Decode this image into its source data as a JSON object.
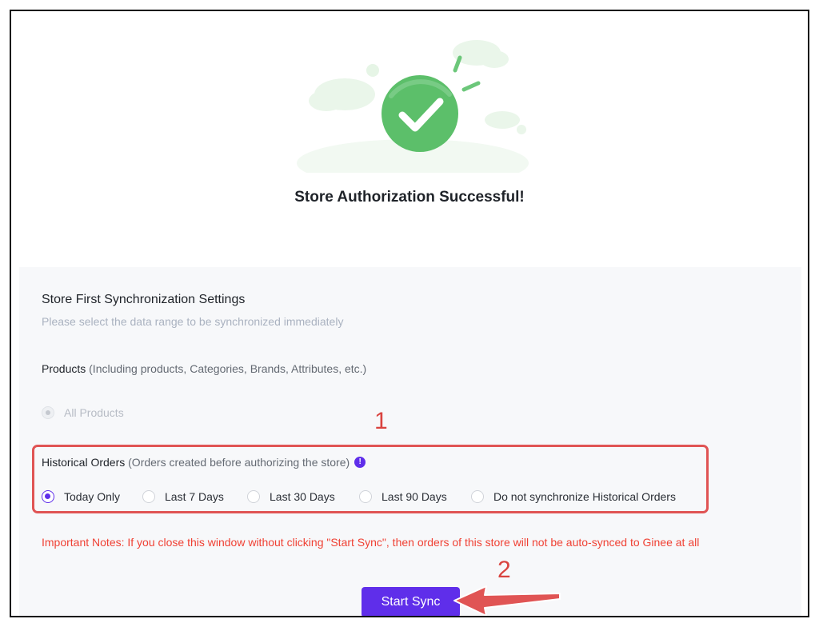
{
  "hero": {
    "title": "Store Authorization Successful!",
    "icon": "check-circle-icon",
    "colors": {
      "success": "#5cbf6a",
      "cloud": "#e9f6ea"
    }
  },
  "settings": {
    "title": "Store First Synchronization Settings",
    "subtitle": "Please select the data range to be synchronized immediately",
    "products": {
      "label": "Products",
      "hint": "(Including products, Categories, Brands, Attributes, etc.)",
      "options": [
        {
          "label": "All Products",
          "checked": true,
          "disabled": true
        }
      ]
    },
    "historical_orders": {
      "label": "Historical Orders",
      "hint": "(Orders created before authorizing the store)",
      "info_icon": "exclamation-icon",
      "options": [
        {
          "label": "Today Only",
          "checked": true
        },
        {
          "label": "Last 7 Days",
          "checked": false
        },
        {
          "label": "Last 30 Days",
          "checked": false
        },
        {
          "label": "Last 90 Days",
          "checked": false
        },
        {
          "label": "Do not synchronize Historical Orders",
          "checked": false
        }
      ]
    },
    "notes": "Important Notes: If you close this window without clicking \"Start Sync\", then orders of this store will not be auto-synced to Ginee at all",
    "start_button": "Start Sync"
  },
  "annotations": {
    "step1": "1",
    "step2": "2",
    "color": "#e05454"
  },
  "colors": {
    "primary": "#5f2eea",
    "danger": "#f04134"
  }
}
